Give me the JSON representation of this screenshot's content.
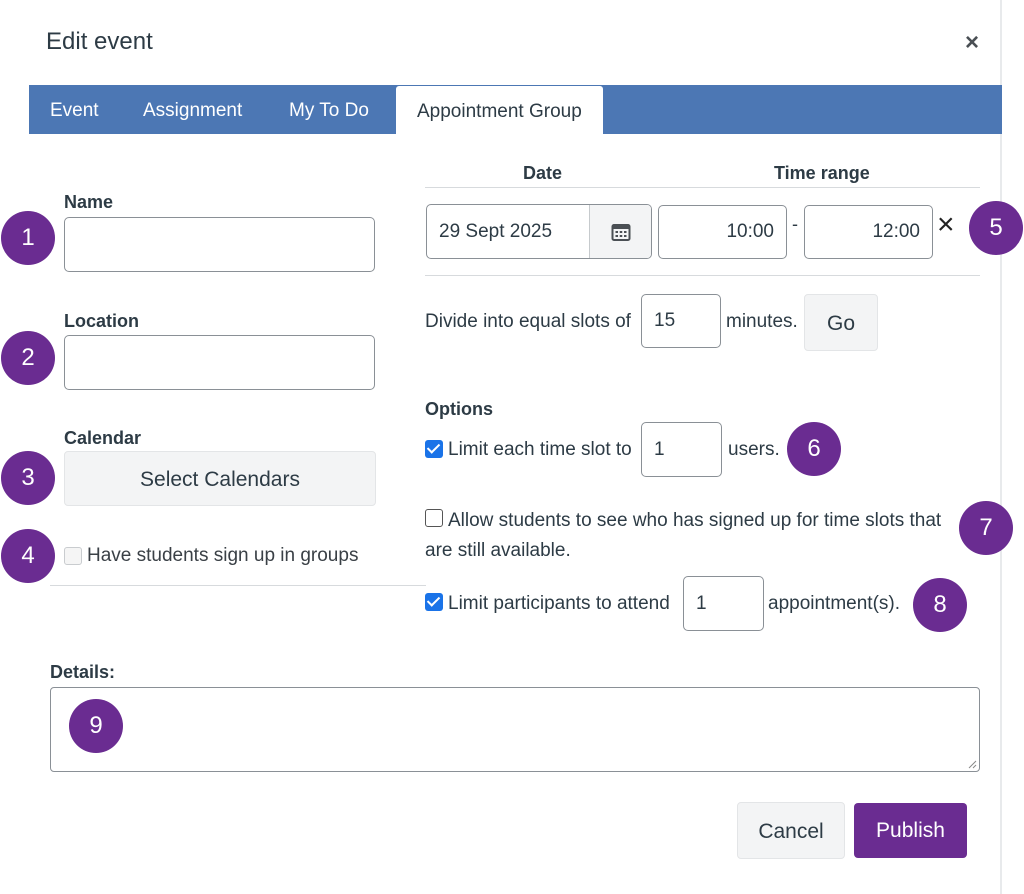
{
  "dialog": {
    "title": "Edit event",
    "close_label": "×"
  },
  "tabs": [
    {
      "label": "Event"
    },
    {
      "label": "Assignment"
    },
    {
      "label": "My To Do"
    },
    {
      "label": "Appointment Group"
    }
  ],
  "form": {
    "name_label": "Name",
    "name_value": "",
    "location_label": "Location",
    "location_value": "",
    "calendar_label": "Calendar",
    "select_calendars_label": "Select Calendars",
    "sign_up_groups_label": "Have students sign up in groups",
    "details_label": "Details:",
    "details_value": ""
  },
  "schedule": {
    "date_header": "Date",
    "time_range_header": "Time range",
    "date_value": "29 Sept 2025",
    "start_time": "10:00",
    "dash": "-",
    "end_time": "12:00",
    "remove_label": "×",
    "divide_prefix": "Divide into equal slots of",
    "divide_value": "15",
    "divide_suffix": "minutes.",
    "go_label": "Go"
  },
  "options": {
    "header": "Options",
    "limit_slot_label": "Limit each time slot to",
    "limit_slot_value": "1",
    "limit_slot_suffix": "users.",
    "allow_see_line1": "Allow students to see who has signed up for time slots that",
    "allow_see_line2": "are still available.",
    "limit_participants_label": "Limit participants to attend",
    "limit_participants_value": "1",
    "limit_participants_suffix": "appointment(s)."
  },
  "footer": {
    "cancel_label": "Cancel",
    "publish_label": "Publish"
  },
  "markers": [
    "1",
    "2",
    "3",
    "4",
    "5",
    "6",
    "7",
    "8",
    "9"
  ],
  "colors": {
    "tab_bar": "#4c77b4",
    "publish": "#6a2c91",
    "marker": "#6a2c91",
    "checkbox": "#1a73e8"
  }
}
